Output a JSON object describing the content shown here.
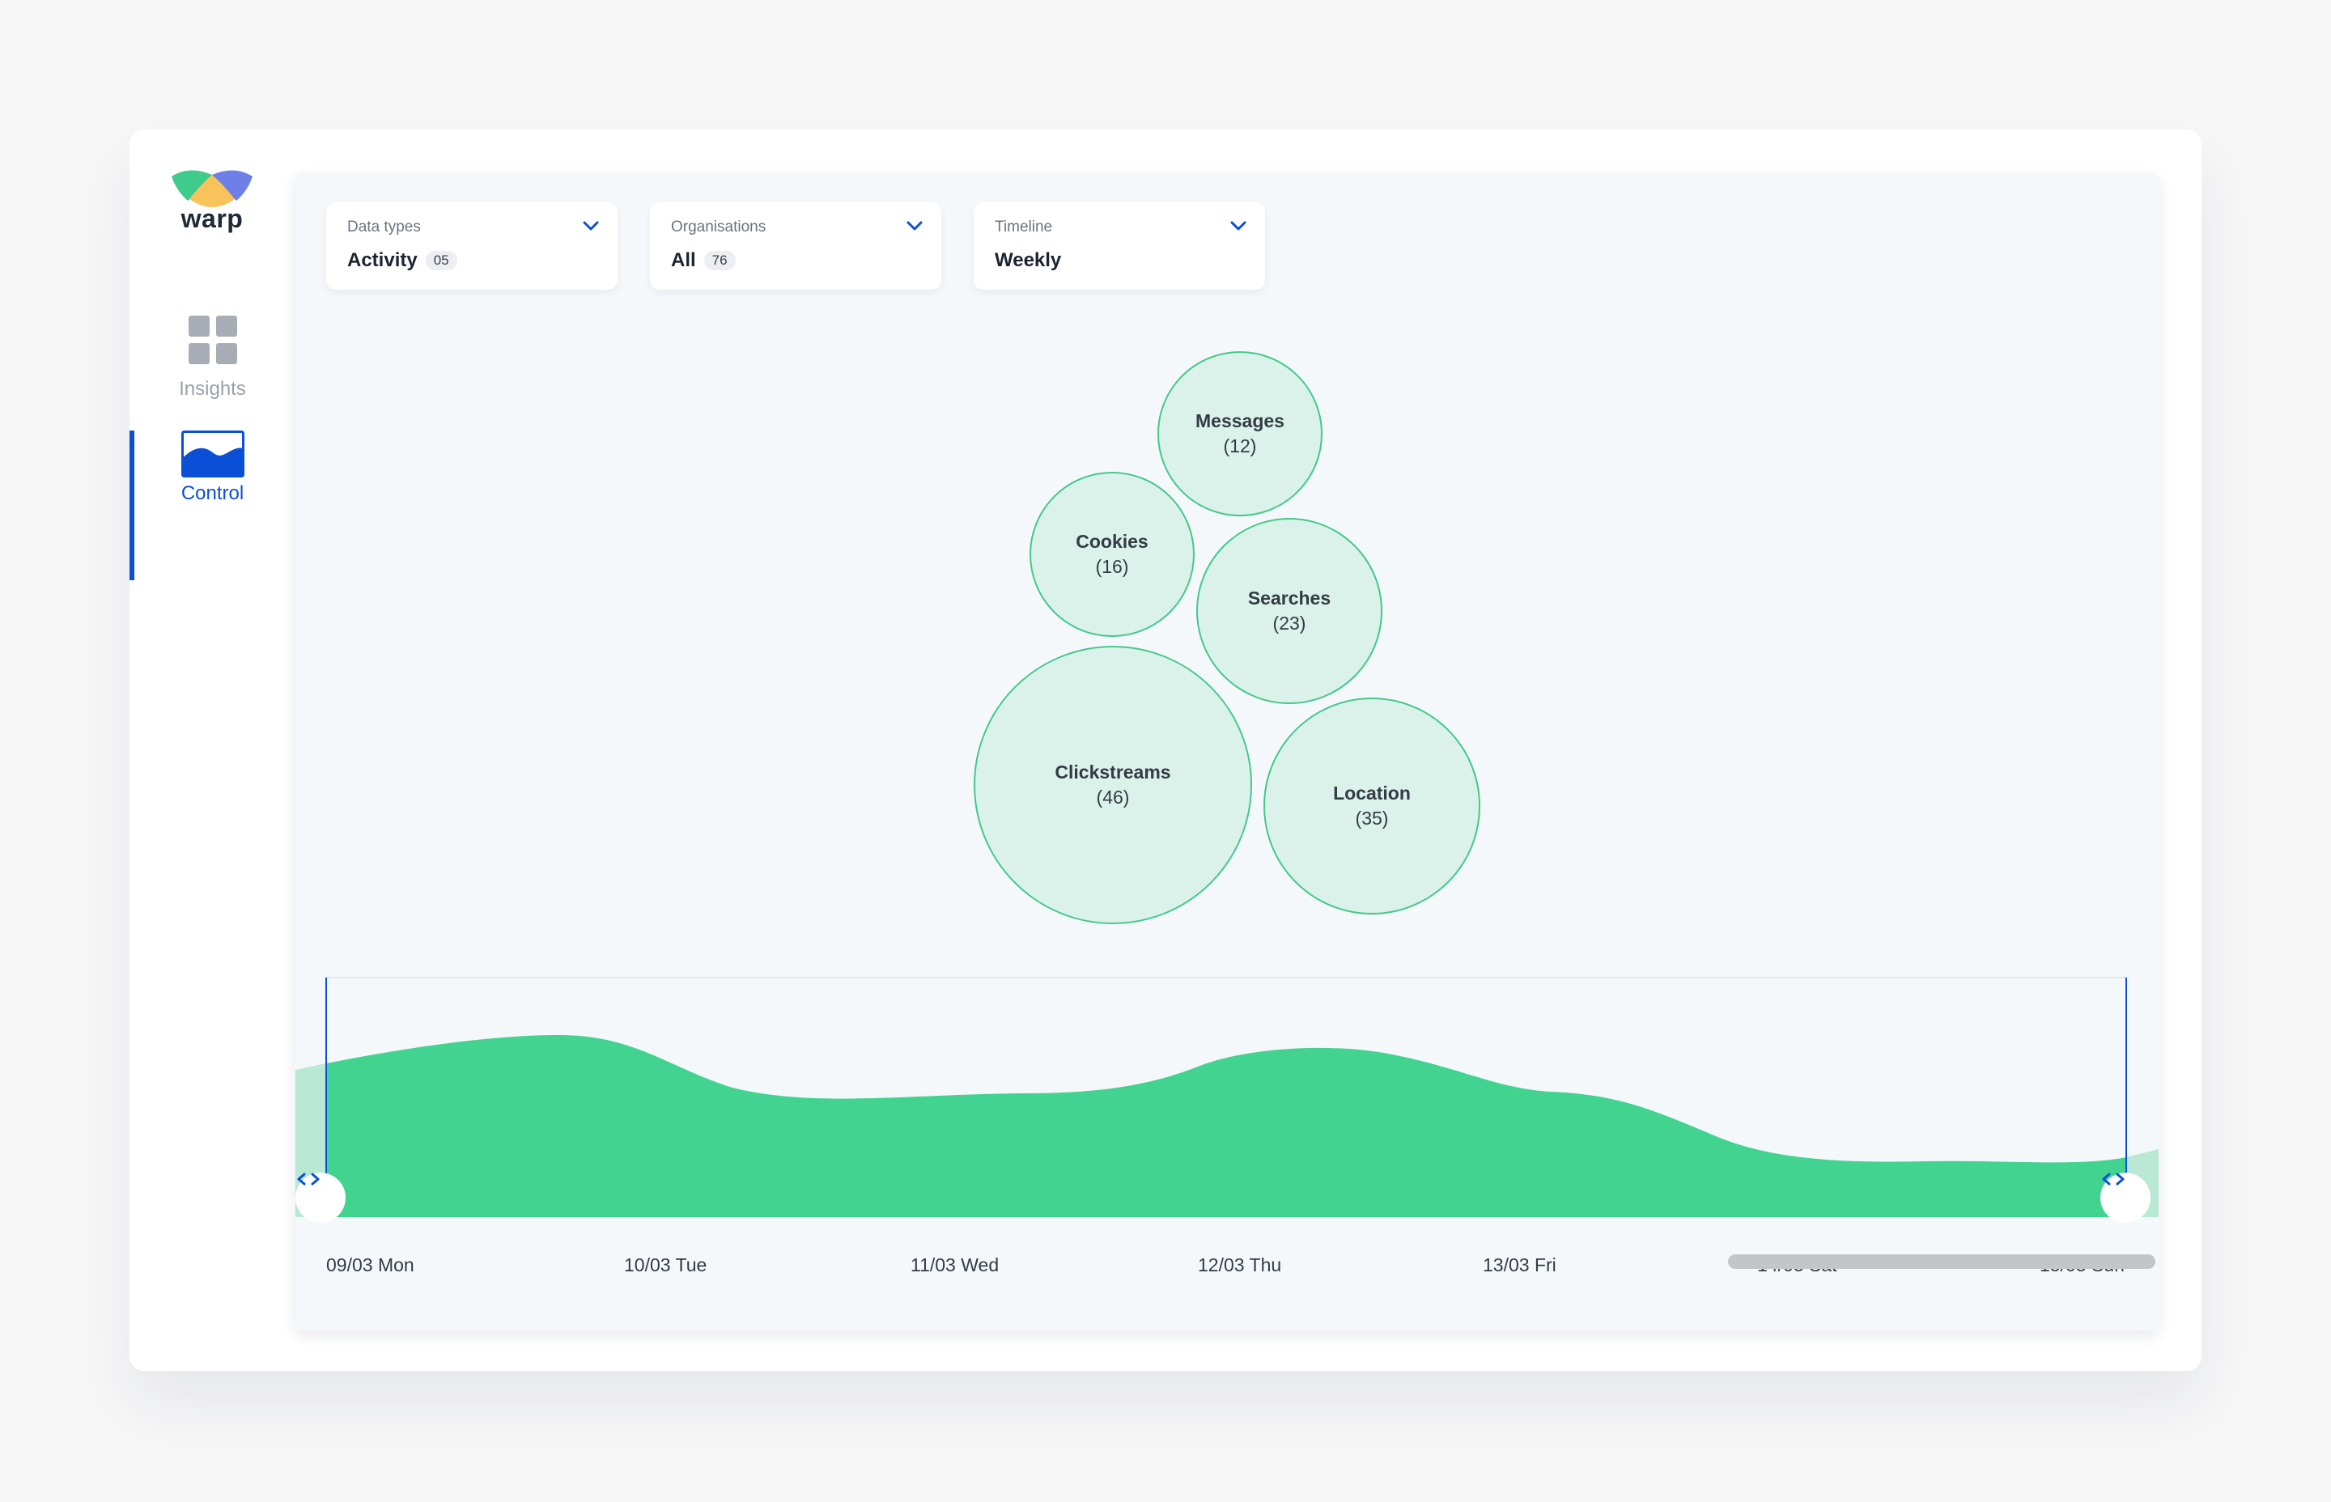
{
  "app": {
    "brand": "warp"
  },
  "sidebar": {
    "items": [
      {
        "label": "Insights",
        "icon": "grid-icon",
        "active": false
      },
      {
        "label": "Control",
        "icon": "wave-chart-icon",
        "active": true
      }
    ]
  },
  "filters": [
    {
      "label": "Data types",
      "value": "Activity",
      "badge": "05"
    },
    {
      "label": "Organisations",
      "value": "All",
      "badge": "76"
    },
    {
      "label": "Timeline",
      "value": "Weekly"
    }
  ],
  "bubbles": [
    {
      "name": "Messages",
      "count": "(12)",
      "value": 12
    },
    {
      "name": "Cookies",
      "count": "(16)",
      "value": 16
    },
    {
      "name": "Searches",
      "count": "(23)",
      "value": 23
    },
    {
      "name": "Clickstreams",
      "count": "(46)",
      "value": 46
    },
    {
      "name": "Location",
      "count": "(35)",
      "value": 35
    }
  ],
  "timeline": {
    "dates": [
      "09/03 Mon",
      "10/03 Tue",
      "11/03 Wed",
      "12/03 Thu",
      "13/03 Fri",
      "14/03 Sat",
      "15/03 Sun"
    ]
  },
  "colors": {
    "accent": "#0b4fd6",
    "area": "#43d391",
    "area_light": "#b9e8d4",
    "bubble_fill": "#dbf2ea",
    "bubble_stroke": "#43c98a"
  }
}
